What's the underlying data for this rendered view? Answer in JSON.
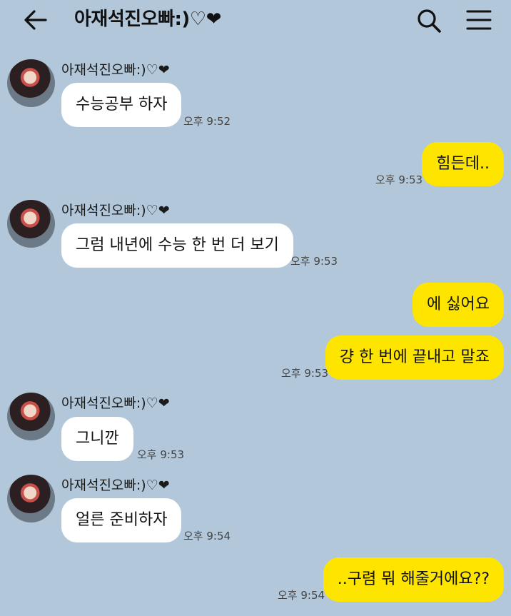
{
  "header": {
    "title": "아재석진오빠:)♡❤",
    "back_icon": "arrow-left-icon",
    "search_icon": "search-icon",
    "menu_icon": "hamburger-menu-icon"
  },
  "messages": [
    {
      "side": "in",
      "sender": "아재석진오빠:)♡❤",
      "text": "수능공부 하자",
      "time": "오후 9:52"
    },
    {
      "side": "out",
      "text": "힘든데..",
      "time": "오후 9:53"
    },
    {
      "side": "in",
      "sender": "아재석진오빠:)♡❤",
      "text": "그럼 내년에 수능 한 번 더 보기",
      "time": "오후 9:53"
    },
    {
      "side": "out",
      "text": "에 싫어요",
      "time": ""
    },
    {
      "side": "out",
      "text": "걍 한 번에 끝내고 말죠",
      "time": "오후 9:53"
    },
    {
      "side": "in",
      "sender": "아재석진오빠:)♡❤",
      "text": "그니깐",
      "time": "오후 9:53"
    },
    {
      "side": "in",
      "sender": "아재석진오빠:)♡❤",
      "text": "얼른 준비하자",
      "time": "오후 9:54"
    },
    {
      "side": "out",
      "text": "..구렴 뭐 해줄거에요??",
      "time": "오후 9:54"
    }
  ],
  "colors": {
    "background": "#b2c7d9",
    "incoming_bubble": "#ffffff",
    "outgoing_bubble": "#fee500"
  }
}
